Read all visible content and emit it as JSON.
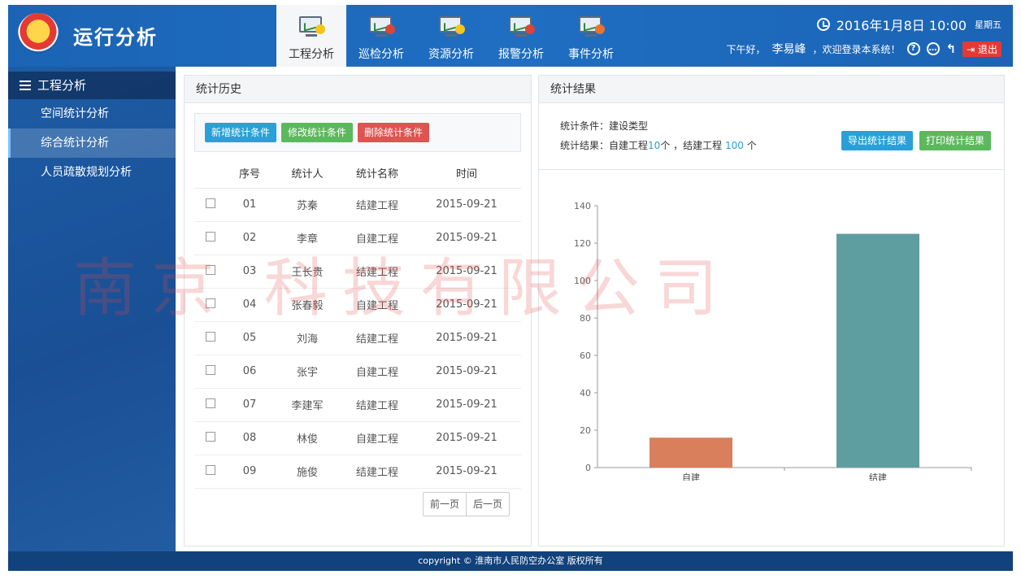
{
  "app": {
    "title": "运行分析"
  },
  "nav": [
    {
      "label": "工程分析",
      "active": true,
      "badge": "#f5c518"
    },
    {
      "label": "巡检分析",
      "active": false,
      "badge": "#d9453a"
    },
    {
      "label": "资源分析",
      "active": false,
      "badge": "#f5c518"
    },
    {
      "label": "报警分析",
      "active": false,
      "badge": "#d9453a"
    },
    {
      "label": "事件分析",
      "active": false,
      "badge": "#e8732c"
    }
  ],
  "header": {
    "datetime": "2016年1月8日 10:00",
    "weekday": "星期五",
    "greeting_prefix": "下午好，",
    "user": "李易峰",
    "greeting_suffix": "，欢迎登录本系统！",
    "help_glyph": "?",
    "logout": "退出"
  },
  "sidebar": {
    "title": "工程分析",
    "items": [
      {
        "label": "空间统计分析",
        "active": false
      },
      {
        "label": "综合统计分析",
        "active": true
      },
      {
        "label": "人员疏散规划分析",
        "active": false
      }
    ]
  },
  "history": {
    "title": "统计历史",
    "buttons": {
      "add": "新增统计条件",
      "edit": "修改统计条件",
      "delete": "删除统计条件"
    },
    "columns": [
      "序号",
      "统计人",
      "统计名称",
      "时间"
    ],
    "rows": [
      [
        "01",
        "苏秦",
        "结建工程",
        "2015-09-21"
      ],
      [
        "02",
        "李章",
        "自建工程",
        "2015-09-21"
      ],
      [
        "03",
        "王长贵",
        "结建工程",
        "2015-09-21"
      ],
      [
        "04",
        "张春毅",
        "自建工程",
        "2015-09-21"
      ],
      [
        "05",
        "刘海",
        "结建工程",
        "2015-09-21"
      ],
      [
        "06",
        "张宇",
        "自建工程",
        "2015-09-21"
      ],
      [
        "07",
        "李建军",
        "结建工程",
        "2015-09-21"
      ],
      [
        "08",
        "林俊",
        "自建工程",
        "2015-09-21"
      ],
      [
        "09",
        "施俊",
        "结建工程",
        "2015-09-21"
      ]
    ],
    "pager": {
      "prev": "前一页",
      "next": "后一页"
    }
  },
  "result": {
    "title": "统计结果",
    "condition_label": "统计条件：",
    "condition_value": "建设类型",
    "result_label": "统计结果：",
    "self_label": "自建工程",
    "self_count": "10",
    "self_unit": "个",
    "sep": "，",
    "joint_label": "结建工程",
    "joint_count": "100",
    "joint_unit": "个",
    "export": "导出统计结果",
    "print": "打印统计结果"
  },
  "chart_data": {
    "type": "bar",
    "categories": [
      "自建",
      "结建"
    ],
    "values": [
      16,
      125
    ],
    "colors": [
      "#d97f5c",
      "#5f9ea0"
    ],
    "ylim": [
      0,
      140
    ],
    "yticks": [
      0,
      20,
      40,
      60,
      80,
      100,
      120,
      140
    ],
    "grid": false
  },
  "footer": {
    "text": "copyright © 淮南市人民防空办公室 版权所有"
  },
  "watermark": {
    "text": "南京 科技有限公司"
  }
}
